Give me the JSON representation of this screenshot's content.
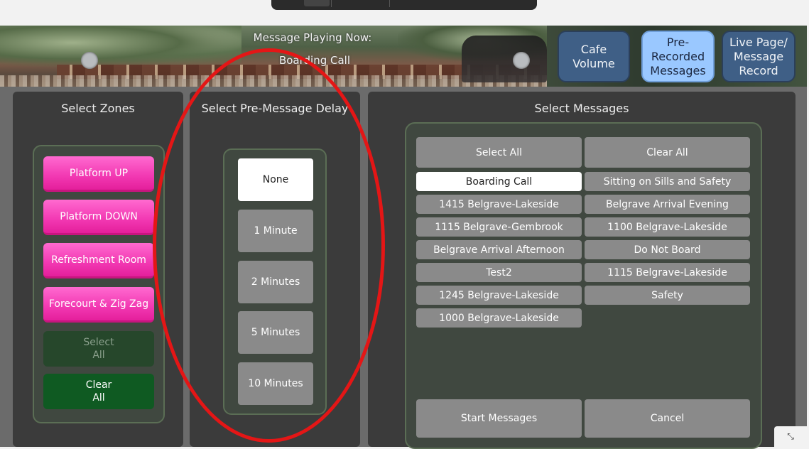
{
  "banner": {
    "message_playing_label": "Message Playing Now:",
    "current_message": "Boarding Call",
    "buttons": [
      {
        "label": "Cafe\nVolume",
        "style": "dark"
      },
      {
        "label": "Pre-\nRecorded\nMessages",
        "style": "light"
      },
      {
        "label": "Live Page/\nMessage\nRecord",
        "style": "dark"
      }
    ]
  },
  "zones": {
    "title": "Select Zones",
    "items": [
      "Platform UP",
      "Platform DOWN",
      "Refreshment Room",
      "Forecourt & Zig Zag"
    ],
    "select_all": "Select\nAll",
    "clear_all": "Clear\nAll"
  },
  "delay": {
    "title": "Select Pre-Message Delay",
    "options": [
      "None",
      "1 Minute",
      "2 Minutes",
      "5 Minutes",
      "10 Minutes"
    ],
    "selected": "None"
  },
  "messages": {
    "title": "Select Messages",
    "select_all": "Select All",
    "clear_all": "Clear All",
    "left_column": [
      "Boarding Call",
      "1415 Belgrave-Lakeside",
      "1115 Belgrave-Gembrook",
      "Belgrave Arrival Afternoon",
      "Test2",
      "1245 Belgrave-Lakeside",
      "1000 Belgrave-Lakeside"
    ],
    "right_column": [
      "Sitting on Sills and Safety",
      "Belgrave Arrival Evening",
      "1100 Belgrave-Lakeside",
      "Do Not Board",
      "1115 Belgrave-Lakeside",
      "Safety"
    ],
    "selected": "Boarding Call",
    "start": "Start Messages",
    "cancel": "Cancel"
  },
  "colors": {
    "accent_annotation": "#e41616",
    "zone_button": "#f238b2",
    "selected_button": "#ffffff",
    "blue_button_light": "#9ac8ff",
    "blue_button_dark": "#3f5f86"
  }
}
